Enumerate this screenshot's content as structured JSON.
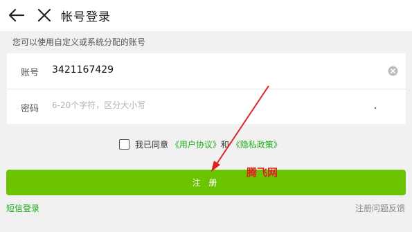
{
  "header": {
    "title": "帐号登录",
    "back_icon": "back-arrow-icon",
    "close_icon": "close-icon"
  },
  "hint": "您可以使用自定义或系统分配的账号",
  "form": {
    "account_label": "账号",
    "account_value": "3421167429",
    "password_label": "密码",
    "password_placeholder": "6-20个字符，区分大小写"
  },
  "agreement": {
    "prefix": "我已同意",
    "user_agreement": "《用户协议》",
    "conjunction": "和",
    "privacy_policy": "《隐私政策》",
    "checked": false
  },
  "register_button": "注 册",
  "footer": {
    "sms_login": "短信登录",
    "feedback": "注册问题反馈"
  },
  "watermark": "腾飞网",
  "colors": {
    "accent_green": "#6cc400",
    "link_green": "#1aad19",
    "annotation_red": "#e02020",
    "background": "#f1f1f1"
  }
}
